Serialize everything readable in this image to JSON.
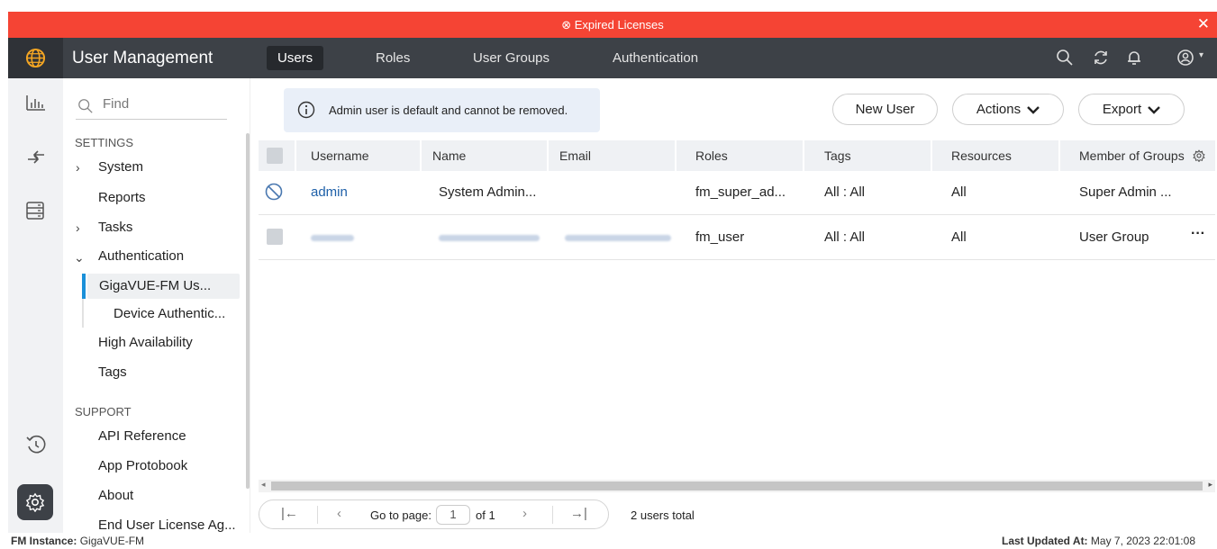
{
  "banner": {
    "text": "Expired Licenses"
  },
  "header": {
    "app_title": "User Management",
    "tabs": [
      {
        "label": "Users",
        "active": true
      },
      {
        "label": "Roles",
        "active": false
      },
      {
        "label": "User Groups",
        "active": false
      },
      {
        "label": "Authentication",
        "active": false
      }
    ]
  },
  "nav": {
    "find_placeholder": "Find",
    "settings_heading": "SETTINGS",
    "items": {
      "system": "System",
      "reports": "Reports",
      "tasks": "Tasks",
      "authentication": "Authentication",
      "gigavue_fm_users": "GigaVUE-FM Us...",
      "device_auth": "Device Authentic...",
      "high_availability": "High Availability",
      "tags": "Tags"
    },
    "support_heading": "SUPPORT",
    "support_items": {
      "api_reference": "API Reference",
      "app_protobook": "App Protobook",
      "about": "About",
      "eula": "End User License Ag..."
    }
  },
  "info_message": "Admin user is default and cannot be removed.",
  "toolbar": {
    "new_user": "New User",
    "actions": "Actions",
    "export": "Export"
  },
  "table": {
    "columns": [
      "Username",
      "Name",
      "Email",
      "Roles",
      "Tags",
      "Resources",
      "Member of Groups"
    ],
    "rows": [
      {
        "username": "admin",
        "name": "System Admin...",
        "email": "",
        "roles": "fm_super_ad...",
        "tags": "All : All",
        "resources": "All",
        "groups": "Super Admin ..."
      },
      {
        "username": "",
        "name": "",
        "email": "",
        "roles": "fm_user",
        "tags": "All : All",
        "resources": "All",
        "groups": "User Group"
      }
    ]
  },
  "pager": {
    "go_to_page": "Go to page:",
    "page": "1",
    "of": "of 1",
    "total": "2 users total"
  },
  "footer": {
    "instance_label": "FM Instance:",
    "instance_value": "GigaVUE-FM",
    "updated_label": "Last Updated At:",
    "updated_value": "May 7, 2023 22:01:08"
  },
  "colors": {
    "banner": "#f54434",
    "header": "#3d4147",
    "accent": "#1a90d9"
  }
}
